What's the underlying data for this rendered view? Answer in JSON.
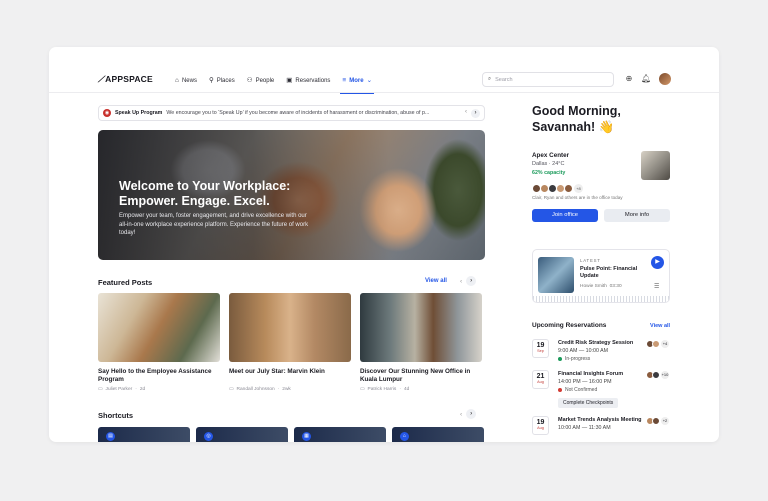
{
  "header": {
    "logo": "APPSPACE",
    "nav": [
      {
        "label": "News",
        "icon": "home-icon"
      },
      {
        "label": "Places",
        "icon": "places-icon"
      },
      {
        "label": "People",
        "icon": "people-icon"
      },
      {
        "label": "Reservations",
        "icon": "calendar-icon"
      },
      {
        "label": "More",
        "icon": "menu-icon",
        "active": true
      }
    ],
    "search_placeholder": "Search"
  },
  "ticker": {
    "title": "Speak Up Program",
    "text": "We encourage you to ‘Speak Up’ if you become aware of incidents of harassment or discrimination, abuse of p..."
  },
  "hero": {
    "headline": "Welcome to Your Workplace: Empower. Engage. Excel.",
    "body": "Empower your team, foster engagement, and drive excellence with our all-in-one workplace experience platform. Experience the future of work today!"
  },
  "featured": {
    "title": "Featured Posts",
    "view_all": "View all",
    "posts": [
      {
        "title": "Say Hello to the Employee Assistance Program",
        "author": "Juliet Parker",
        "age": "2d"
      },
      {
        "title": "Meet our July Star: Marvin Klein",
        "author": "Randall Johnsson",
        "age": "2wk"
      },
      {
        "title": "Discover Our Stunning New Office in Kuala Lumpur",
        "author": "Patrick Harris",
        "age": "4d"
      }
    ]
  },
  "shortcuts": {
    "title": "Shortcuts"
  },
  "greeting": "Good Morning, Savannah! 👋",
  "location": {
    "name": "Apex Center",
    "weather": "Dallas · 24°C",
    "capacity": "62% capacity",
    "people_more": "+8",
    "people_note": "Clair, Ryan and others are in the office today",
    "join_label": "Join office",
    "more_label": "More info"
  },
  "podcast": {
    "label": "LATEST",
    "title": "Pulse Point: Financial Update",
    "author": "Howie Smith",
    "duration": "03:30"
  },
  "reservations": {
    "title": "Upcoming Reservations",
    "view_all": "View all",
    "items": [
      {
        "day": "19",
        "month": "Sep",
        "name": "Credit Risk Strategy Session",
        "time": "9:00 AM — 10:00 AM",
        "status": "In-progress",
        "status_color": "#1a9a5a",
        "more": "+4"
      },
      {
        "day": "21",
        "month": "Aug",
        "name": "Financial Insights Forum",
        "time": "14:00 PM — 16:00 PM",
        "status": "Not Confirmed",
        "status_color": "#d23b33",
        "more": "+10",
        "action": "Complete Checkpoints"
      },
      {
        "day": "19",
        "month": "Aug",
        "name": "Market Trends Analysis Meeting",
        "time": "10:00 AM — 11:30 AM",
        "status": "",
        "more": "+2"
      }
    ]
  }
}
